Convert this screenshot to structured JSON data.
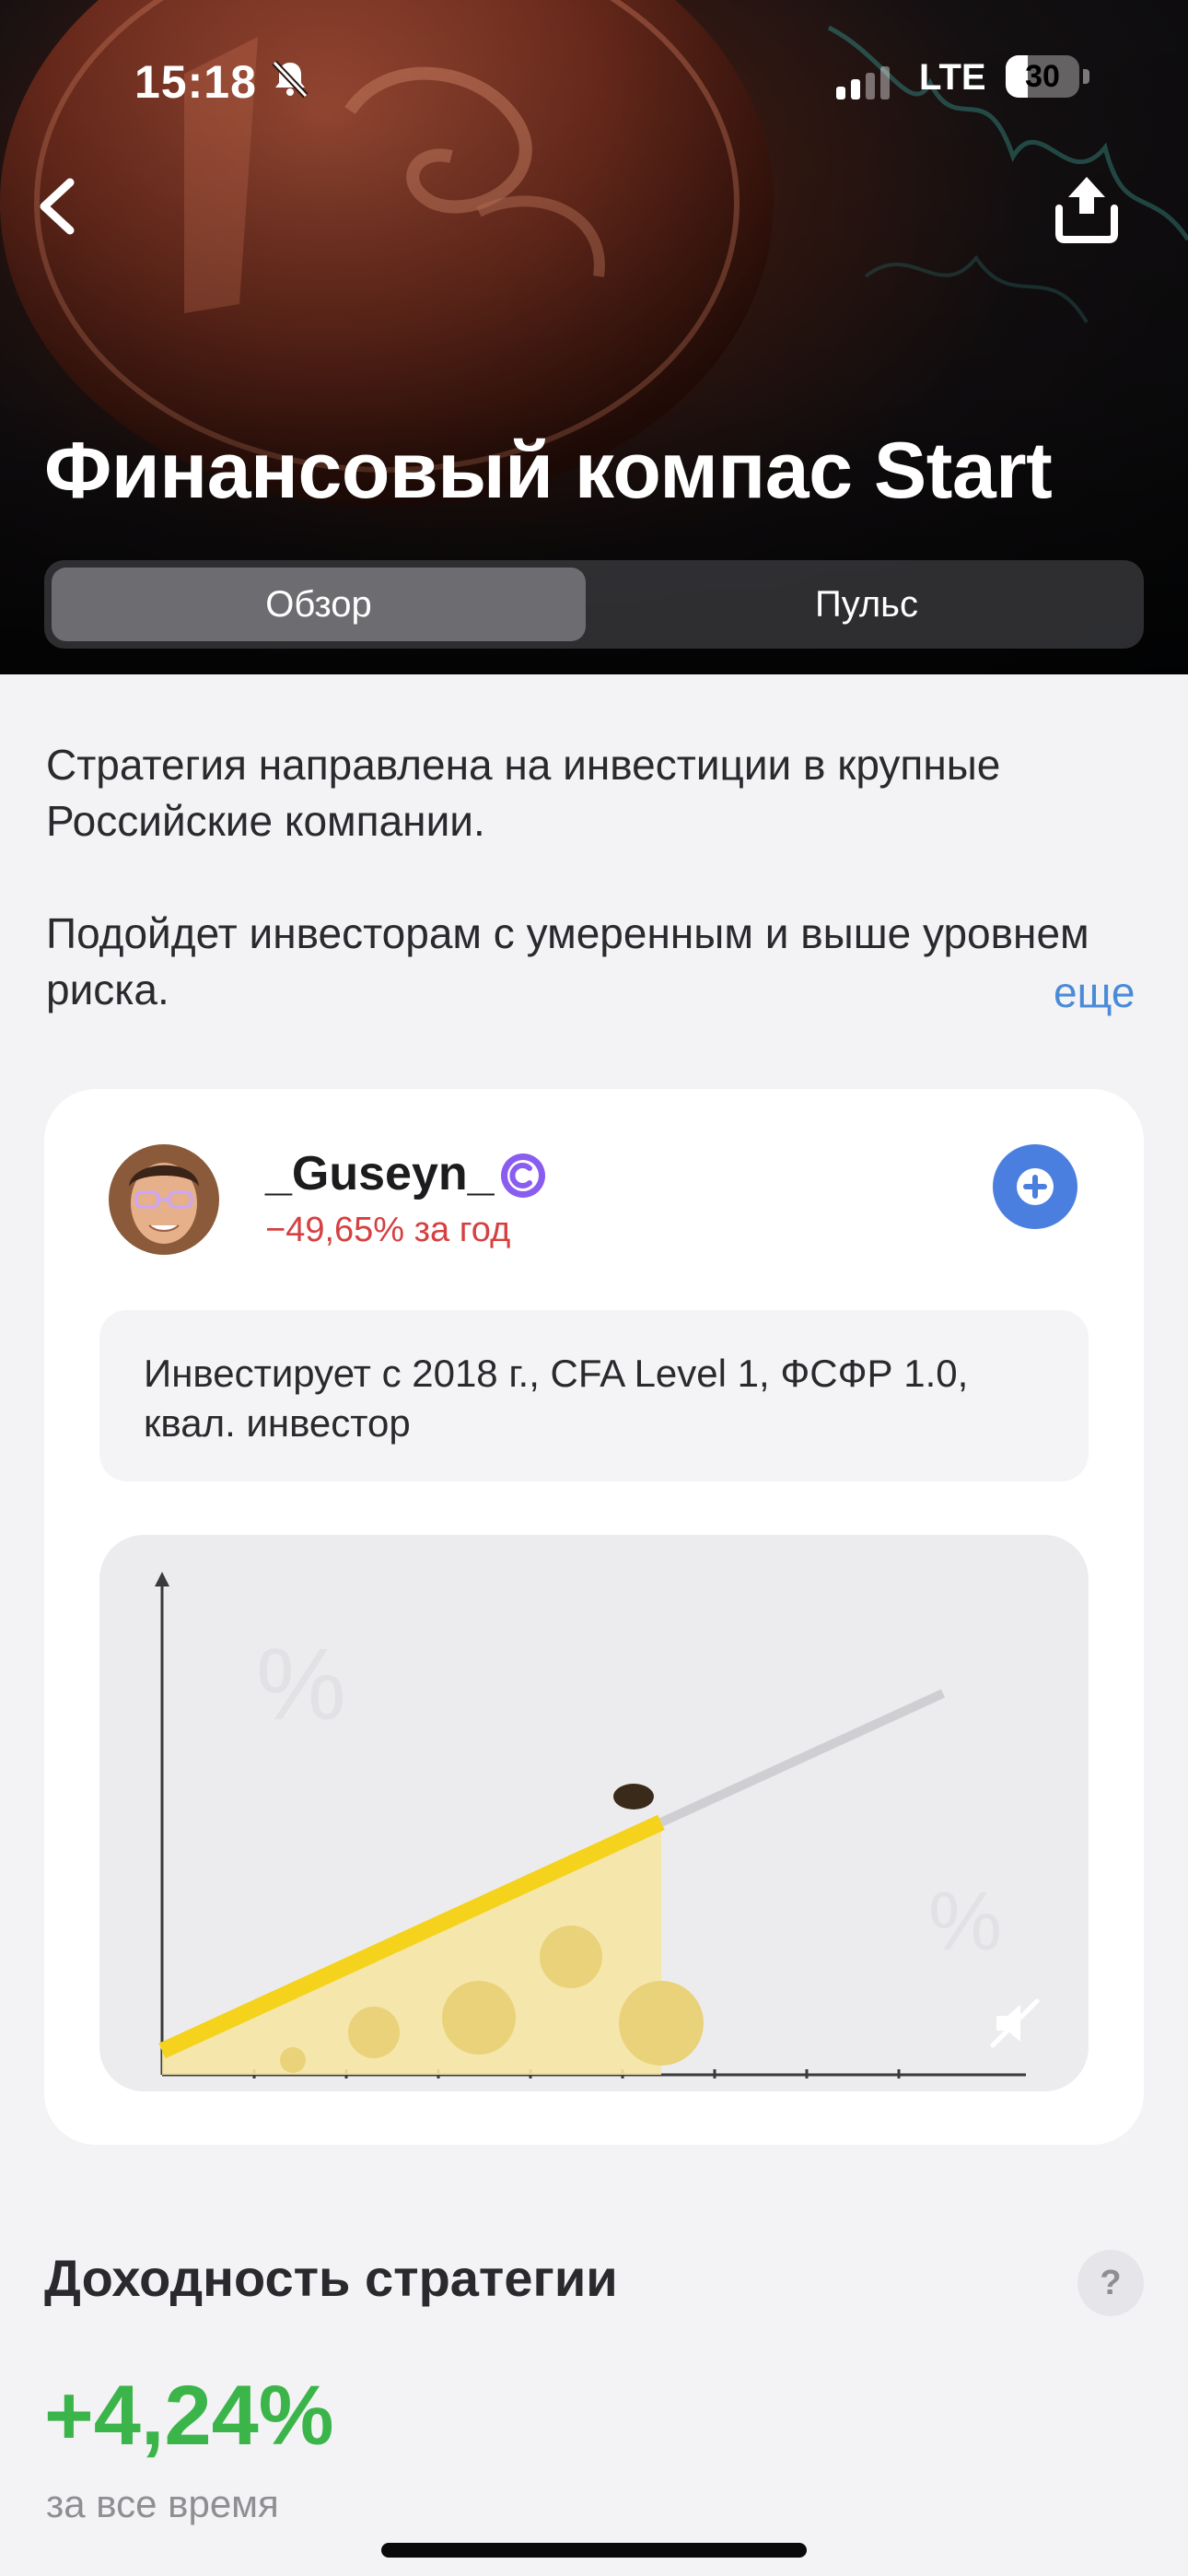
{
  "status_bar": {
    "time": "15:18",
    "network": "LTE",
    "battery_level": "30",
    "battery_fraction": 0.3
  },
  "header": {
    "title": "Финансовый компас Start",
    "tabs": [
      {
        "label": "Обзор",
        "active": true
      },
      {
        "label": "Пульс",
        "active": false
      }
    ]
  },
  "description": {
    "paragraphs": [
      "Стратегия направлена на инвестиции в крупные Российские компании.",
      "Подойдет инвесторам с умеренным и выше уровнем риска."
    ],
    "more_label": "еще"
  },
  "author": {
    "name": "_Guseyn_",
    "return_text": "−49,65% за год",
    "bio": "Инвестирует с 2018 г., CFA Level 1, ФСФР 1.0, квал. инвестор"
  },
  "returns": {
    "title": "Доходность стратегии",
    "help_label": "?",
    "value": "+4,24%",
    "caption": "за все время"
  },
  "colors": {
    "accent_blue": "#4a7fe0",
    "link_blue": "#4a8bd8",
    "negative_red": "#d64040",
    "positive_green": "#3bb54a",
    "badge_purple": "#8a5cf0"
  },
  "icons": [
    "back-chevron-icon",
    "share-icon",
    "bell-slash-icon",
    "signal-icon",
    "battery-icon",
    "verified-badge-icon",
    "plus-icon",
    "mute-icon"
  ]
}
